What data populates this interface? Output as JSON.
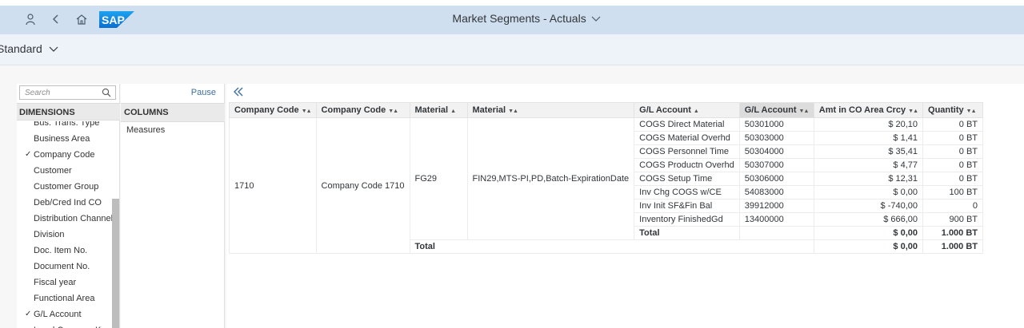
{
  "shell": {
    "title": "Market Segments - Actuals",
    "logo_text": "SAP"
  },
  "variant": {
    "label": "Standard"
  },
  "dimensions": {
    "search_placeholder": "Search",
    "header": "DIMENSIONS",
    "items": [
      {
        "label": "Bus. Trans. Type",
        "checked": false
      },
      {
        "label": "Business Area",
        "checked": false
      },
      {
        "label": "Company Code",
        "checked": true
      },
      {
        "label": "Customer",
        "checked": false
      },
      {
        "label": "Customer Group",
        "checked": false
      },
      {
        "label": "Deb/Cred Ind CO",
        "checked": false
      },
      {
        "label": "Distribution Channel",
        "checked": false
      },
      {
        "label": "Division",
        "checked": false
      },
      {
        "label": "Doc. Item No.",
        "checked": false
      },
      {
        "label": "Document No.",
        "checked": false
      },
      {
        "label": "Fiscal year",
        "checked": false
      },
      {
        "label": "Functional Area",
        "checked": false
      },
      {
        "label": "G/L Account",
        "checked": true
      },
      {
        "label": "Local Currency Key",
        "checked": false
      }
    ]
  },
  "columns_panel": {
    "pause_label": "Pause",
    "header": "COLUMNS",
    "measures_label": "Measures"
  },
  "grid": {
    "headers": [
      "Company Code",
      "Company Code",
      "Material",
      "Material",
      "G/L Account",
      "G/L Account",
      "Amt in CO Area Crcy",
      "Quantity"
    ],
    "company_code": "1710",
    "company_code_text": "Company Code 1710",
    "material": "FG29",
    "material_text": "FIN29,MTS-PI,PD,Batch-ExpirationDate",
    "rows": [
      {
        "gl_text": "COGS Direct Material",
        "gl": "50301000",
        "amt": "$ 20,10",
        "qty": "0 BT"
      },
      {
        "gl_text": "COGS Material Overhd",
        "gl": "50303000",
        "amt": "$ 1,41",
        "qty": "0 BT"
      },
      {
        "gl_text": "COGS Personnel Time",
        "gl": "50304000",
        "amt": "$ 35,41",
        "qty": "0 BT"
      },
      {
        "gl_text": "COGS Productn Overhd",
        "gl": "50307000",
        "amt": "$ 4,77",
        "qty": "0 BT"
      },
      {
        "gl_text": "COGS Setup Time",
        "gl": "50306000",
        "amt": "$ 12,31",
        "qty": "0 BT"
      },
      {
        "gl_text": "Inv Chg COGS w/CE",
        "gl": "54083000",
        "amt": "$ 0,00",
        "qty": "100 BT"
      },
      {
        "gl_text": "Inv Init SF&Fin Bal",
        "gl": "39912000",
        "amt": "$ -740,00",
        "qty": "0"
      },
      {
        "gl_text": "Inventory FinishedGd",
        "gl": "13400000",
        "amt": "$ 666,00",
        "qty": "900 BT"
      }
    ],
    "subtotal": {
      "label": "Total",
      "amt": "$ 0,00",
      "qty": "1.000 BT"
    },
    "total": {
      "label": "Total",
      "amt": "$ 0,00",
      "qty": "1.000 BT"
    }
  }
}
